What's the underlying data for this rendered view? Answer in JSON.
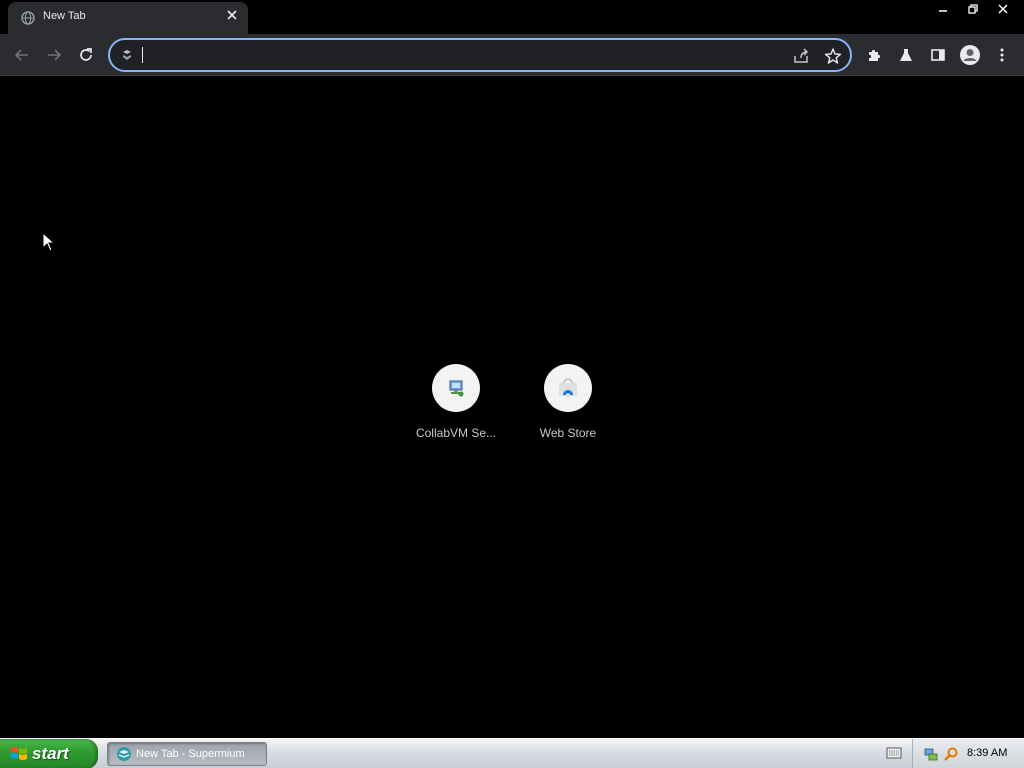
{
  "browser": {
    "tab": {
      "title": "New Tab",
      "favicon": "globe-icon"
    },
    "omnibox": {
      "value": "",
      "placeholder": ""
    }
  },
  "shortcuts": [
    {
      "label": "CollabVM Se...",
      "icon": "computer-network-icon"
    },
    {
      "label": "Web Store",
      "icon": "web-store-icon"
    }
  ],
  "taskbar": {
    "start_label": "start",
    "task_item_label": "New Tab - Supermium",
    "clock": "8:39 AM"
  },
  "colors": {
    "accent": "#8ab4f8",
    "toolbar": "#2b2c2f",
    "page_background": "#000000",
    "start_green": "#2f9a2f"
  }
}
